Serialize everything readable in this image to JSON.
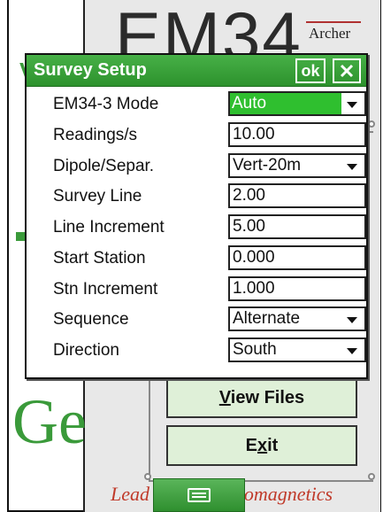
{
  "background": {
    "title": "EM34",
    "brand": "Archer",
    "side_text": "Ge",
    "left_letter": "V",
    "tagline_left": "Lead",
    "tagline_right": "tromagnetics",
    "view_files_label": "View Files",
    "exit_label": "Exit",
    "keyboard_icon": "keyboard-icon"
  },
  "dialog": {
    "title": "Survey Setup",
    "ok_label": "ok",
    "close_icon": "close-icon",
    "fields": [
      {
        "label": "EM34-3 Mode",
        "value": "Auto",
        "type": "select"
      },
      {
        "label": "Readings/s",
        "value": "10.00",
        "type": "input"
      },
      {
        "label": "Dipole/Separ.",
        "value": "Vert-20m",
        "type": "select"
      },
      {
        "label": "Survey Line",
        "value": "2.00",
        "type": "input"
      },
      {
        "label": "Line Increment",
        "value": "5.00",
        "type": "input"
      },
      {
        "label": "Start Station",
        "value": "0.000",
        "type": "input"
      },
      {
        "label": "Stn Increment",
        "value": "1.000",
        "type": "input"
      },
      {
        "label": "Sequence",
        "value": "Alternate",
        "type": "select"
      },
      {
        "label": "Direction",
        "value": "South",
        "type": "select"
      }
    ]
  },
  "colors": {
    "accent_green": "#2d922d",
    "selection_green": "#2fbf2f",
    "tagline_red": "#c03a2a"
  }
}
